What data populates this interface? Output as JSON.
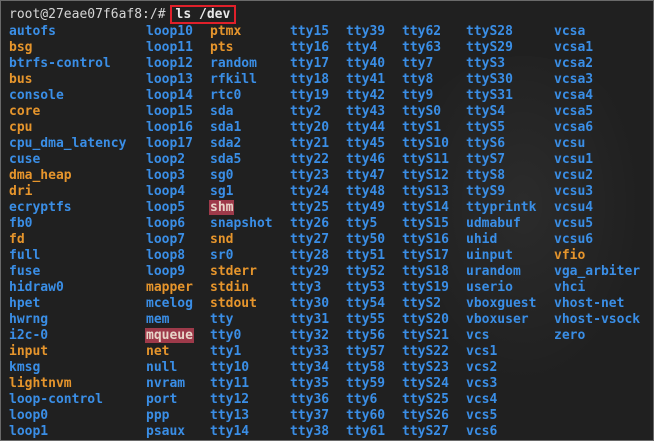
{
  "prompt": {
    "text": "root@27eae07f6af8:/#",
    "command": "ls /dev"
  },
  "colors": {
    "directory": "#3a8ee6",
    "device": "#e6952c",
    "highlight_bg": "#9e3a4a"
  },
  "columns": [
    [
      {
        "name": "autofs",
        "type": "dir"
      },
      {
        "name": "bsg",
        "type": "dev"
      },
      {
        "name": "btrfs-control",
        "type": "dir"
      },
      {
        "name": "bus",
        "type": "dev"
      },
      {
        "name": "console",
        "type": "dir"
      },
      {
        "name": "core",
        "type": "dev"
      },
      {
        "name": "cpu",
        "type": "dev"
      },
      {
        "name": "cpu_dma_latency",
        "type": "dir"
      },
      {
        "name": "cuse",
        "type": "dir"
      },
      {
        "name": "dma_heap",
        "type": "dev"
      },
      {
        "name": "dri",
        "type": "dev"
      },
      {
        "name": "ecryptfs",
        "type": "dir"
      },
      {
        "name": "fb0",
        "type": "dir"
      },
      {
        "name": "fd",
        "type": "dev"
      },
      {
        "name": "full",
        "type": "dir"
      },
      {
        "name": "fuse",
        "type": "dir"
      },
      {
        "name": "hidraw0",
        "type": "dir"
      },
      {
        "name": "hpet",
        "type": "dir"
      },
      {
        "name": "hwrng",
        "type": "dir"
      },
      {
        "name": "i2c-0",
        "type": "dir"
      },
      {
        "name": "input",
        "type": "dev"
      },
      {
        "name": "kmsg",
        "type": "dir"
      },
      {
        "name": "lightnvm",
        "type": "dev"
      },
      {
        "name": "loop-control",
        "type": "dir"
      },
      {
        "name": "loop0",
        "type": "dir"
      },
      {
        "name": "loop1",
        "type": "dir"
      }
    ],
    [
      {
        "name": "loop10",
        "type": "dir"
      },
      {
        "name": "loop11",
        "type": "dir"
      },
      {
        "name": "loop12",
        "type": "dir"
      },
      {
        "name": "loop13",
        "type": "dir"
      },
      {
        "name": "loop14",
        "type": "dir"
      },
      {
        "name": "loop15",
        "type": "dir"
      },
      {
        "name": "loop16",
        "type": "dir"
      },
      {
        "name": "loop17",
        "type": "dir"
      },
      {
        "name": "loop2",
        "type": "dir"
      },
      {
        "name": "loop3",
        "type": "dir"
      },
      {
        "name": "loop4",
        "type": "dir"
      },
      {
        "name": "loop5",
        "type": "dir"
      },
      {
        "name": "loop6",
        "type": "dir"
      },
      {
        "name": "loop7",
        "type": "dir"
      },
      {
        "name": "loop8",
        "type": "dir"
      },
      {
        "name": "loop9",
        "type": "dir"
      },
      {
        "name": "mapper",
        "type": "dev"
      },
      {
        "name": "mcelog",
        "type": "dir"
      },
      {
        "name": "mem",
        "type": "dir"
      },
      {
        "name": "mqueue",
        "type": "hl"
      },
      {
        "name": "net",
        "type": "dev"
      },
      {
        "name": "null",
        "type": "dir"
      },
      {
        "name": "nvram",
        "type": "dir"
      },
      {
        "name": "port",
        "type": "dir"
      },
      {
        "name": "ppp",
        "type": "dir"
      },
      {
        "name": "psaux",
        "type": "dir"
      }
    ],
    [
      {
        "name": "ptmx",
        "type": "dev"
      },
      {
        "name": "pts",
        "type": "dev"
      },
      {
        "name": "random",
        "type": "dir"
      },
      {
        "name": "rfkill",
        "type": "dir"
      },
      {
        "name": "rtc0",
        "type": "dir"
      },
      {
        "name": "sda",
        "type": "dir"
      },
      {
        "name": "sda1",
        "type": "dir"
      },
      {
        "name": "sda2",
        "type": "dir"
      },
      {
        "name": "sda5",
        "type": "dir"
      },
      {
        "name": "sg0",
        "type": "dir"
      },
      {
        "name": "sg1",
        "type": "dir"
      },
      {
        "name": "shm",
        "type": "hl"
      },
      {
        "name": "snapshot",
        "type": "dir"
      },
      {
        "name": "snd",
        "type": "dev"
      },
      {
        "name": "sr0",
        "type": "dir"
      },
      {
        "name": "stderr",
        "type": "dev"
      },
      {
        "name": "stdin",
        "type": "dev"
      },
      {
        "name": "stdout",
        "type": "dev"
      },
      {
        "name": "tty",
        "type": "dir"
      },
      {
        "name": "tty0",
        "type": "dir"
      },
      {
        "name": "tty1",
        "type": "dir"
      },
      {
        "name": "tty10",
        "type": "dir"
      },
      {
        "name": "tty11",
        "type": "dir"
      },
      {
        "name": "tty12",
        "type": "dir"
      },
      {
        "name": "tty13",
        "type": "dir"
      },
      {
        "name": "tty14",
        "type": "dir"
      }
    ],
    [
      {
        "name": "tty15",
        "type": "dir"
      },
      {
        "name": "tty16",
        "type": "dir"
      },
      {
        "name": "tty17",
        "type": "dir"
      },
      {
        "name": "tty18",
        "type": "dir"
      },
      {
        "name": "tty19",
        "type": "dir"
      },
      {
        "name": "tty2",
        "type": "dir"
      },
      {
        "name": "tty20",
        "type": "dir"
      },
      {
        "name": "tty21",
        "type": "dir"
      },
      {
        "name": "tty22",
        "type": "dir"
      },
      {
        "name": "tty23",
        "type": "dir"
      },
      {
        "name": "tty24",
        "type": "dir"
      },
      {
        "name": "tty25",
        "type": "dir"
      },
      {
        "name": "tty26",
        "type": "dir"
      },
      {
        "name": "tty27",
        "type": "dir"
      },
      {
        "name": "tty28",
        "type": "dir"
      },
      {
        "name": "tty29",
        "type": "dir"
      },
      {
        "name": "tty3",
        "type": "dir"
      },
      {
        "name": "tty30",
        "type": "dir"
      },
      {
        "name": "tty31",
        "type": "dir"
      },
      {
        "name": "tty32",
        "type": "dir"
      },
      {
        "name": "tty33",
        "type": "dir"
      },
      {
        "name": "tty34",
        "type": "dir"
      },
      {
        "name": "tty35",
        "type": "dir"
      },
      {
        "name": "tty36",
        "type": "dir"
      },
      {
        "name": "tty37",
        "type": "dir"
      },
      {
        "name": "tty38",
        "type": "dir"
      }
    ],
    [
      {
        "name": "tty39",
        "type": "dir"
      },
      {
        "name": "tty4",
        "type": "dir"
      },
      {
        "name": "tty40",
        "type": "dir"
      },
      {
        "name": "tty41",
        "type": "dir"
      },
      {
        "name": "tty42",
        "type": "dir"
      },
      {
        "name": "tty43",
        "type": "dir"
      },
      {
        "name": "tty44",
        "type": "dir"
      },
      {
        "name": "tty45",
        "type": "dir"
      },
      {
        "name": "tty46",
        "type": "dir"
      },
      {
        "name": "tty47",
        "type": "dir"
      },
      {
        "name": "tty48",
        "type": "dir"
      },
      {
        "name": "tty49",
        "type": "dir"
      },
      {
        "name": "tty5",
        "type": "dir"
      },
      {
        "name": "tty50",
        "type": "dir"
      },
      {
        "name": "tty51",
        "type": "dir"
      },
      {
        "name": "tty52",
        "type": "dir"
      },
      {
        "name": "tty53",
        "type": "dir"
      },
      {
        "name": "tty54",
        "type": "dir"
      },
      {
        "name": "tty55",
        "type": "dir"
      },
      {
        "name": "tty56",
        "type": "dir"
      },
      {
        "name": "tty57",
        "type": "dir"
      },
      {
        "name": "tty58",
        "type": "dir"
      },
      {
        "name": "tty59",
        "type": "dir"
      },
      {
        "name": "tty6",
        "type": "dir"
      },
      {
        "name": "tty60",
        "type": "dir"
      },
      {
        "name": "tty61",
        "type": "dir"
      }
    ],
    [
      {
        "name": "tty62",
        "type": "dir"
      },
      {
        "name": "tty63",
        "type": "dir"
      },
      {
        "name": "tty7",
        "type": "dir"
      },
      {
        "name": "tty8",
        "type": "dir"
      },
      {
        "name": "tty9",
        "type": "dir"
      },
      {
        "name": "ttyS0",
        "type": "dir"
      },
      {
        "name": "ttyS1",
        "type": "dir"
      },
      {
        "name": "ttyS10",
        "type": "dir"
      },
      {
        "name": "ttyS11",
        "type": "dir"
      },
      {
        "name": "ttyS12",
        "type": "dir"
      },
      {
        "name": "ttyS13",
        "type": "dir"
      },
      {
        "name": "ttyS14",
        "type": "dir"
      },
      {
        "name": "ttyS15",
        "type": "dir"
      },
      {
        "name": "ttyS16",
        "type": "dir"
      },
      {
        "name": "ttyS17",
        "type": "dir"
      },
      {
        "name": "ttyS18",
        "type": "dir"
      },
      {
        "name": "ttyS19",
        "type": "dir"
      },
      {
        "name": "ttyS2",
        "type": "dir"
      },
      {
        "name": "ttyS20",
        "type": "dir"
      },
      {
        "name": "ttyS21",
        "type": "dir"
      },
      {
        "name": "ttyS22",
        "type": "dir"
      },
      {
        "name": "ttyS23",
        "type": "dir"
      },
      {
        "name": "ttyS24",
        "type": "dir"
      },
      {
        "name": "ttyS25",
        "type": "dir"
      },
      {
        "name": "ttyS26",
        "type": "dir"
      },
      {
        "name": "ttyS27",
        "type": "dir"
      }
    ],
    [
      {
        "name": "ttyS28",
        "type": "dir"
      },
      {
        "name": "ttyS29",
        "type": "dir"
      },
      {
        "name": "ttyS3",
        "type": "dir"
      },
      {
        "name": "ttyS30",
        "type": "dir"
      },
      {
        "name": "ttyS31",
        "type": "dir"
      },
      {
        "name": "ttyS4",
        "type": "dir"
      },
      {
        "name": "ttyS5",
        "type": "dir"
      },
      {
        "name": "ttyS6",
        "type": "dir"
      },
      {
        "name": "ttyS7",
        "type": "dir"
      },
      {
        "name": "ttyS8",
        "type": "dir"
      },
      {
        "name": "ttyS9",
        "type": "dir"
      },
      {
        "name": "ttyprintk",
        "type": "dir"
      },
      {
        "name": "udmabuf",
        "type": "dir"
      },
      {
        "name": "uhid",
        "type": "dir"
      },
      {
        "name": "uinput",
        "type": "dir"
      },
      {
        "name": "urandom",
        "type": "dir"
      },
      {
        "name": "userio",
        "type": "dir"
      },
      {
        "name": "vboxguest",
        "type": "dir"
      },
      {
        "name": "vboxuser",
        "type": "dir"
      },
      {
        "name": "vcs",
        "type": "dir"
      },
      {
        "name": "vcs1",
        "type": "dir"
      },
      {
        "name": "vcs2",
        "type": "dir"
      },
      {
        "name": "vcs3",
        "type": "dir"
      },
      {
        "name": "vcs4",
        "type": "dir"
      },
      {
        "name": "vcs5",
        "type": "dir"
      },
      {
        "name": "vcs6",
        "type": "dir"
      }
    ],
    [
      {
        "name": "vcsa",
        "type": "dir"
      },
      {
        "name": "vcsa1",
        "type": "dir"
      },
      {
        "name": "vcsa2",
        "type": "dir"
      },
      {
        "name": "vcsa3",
        "type": "dir"
      },
      {
        "name": "vcsa4",
        "type": "dir"
      },
      {
        "name": "vcsa5",
        "type": "dir"
      },
      {
        "name": "vcsa6",
        "type": "dir"
      },
      {
        "name": "vcsu",
        "type": "dir"
      },
      {
        "name": "vcsu1",
        "type": "dir"
      },
      {
        "name": "vcsu2",
        "type": "dir"
      },
      {
        "name": "vcsu3",
        "type": "dir"
      },
      {
        "name": "vcsu4",
        "type": "dir"
      },
      {
        "name": "vcsu5",
        "type": "dir"
      },
      {
        "name": "vcsu6",
        "type": "dir"
      },
      {
        "name": "vfio",
        "type": "dev"
      },
      {
        "name": "vga_arbiter",
        "type": "dir"
      },
      {
        "name": "vhci",
        "type": "dir"
      },
      {
        "name": "vhost-net",
        "type": "dir"
      },
      {
        "name": "vhost-vsock",
        "type": "dir"
      },
      {
        "name": "zero",
        "type": "dir"
      }
    ]
  ]
}
